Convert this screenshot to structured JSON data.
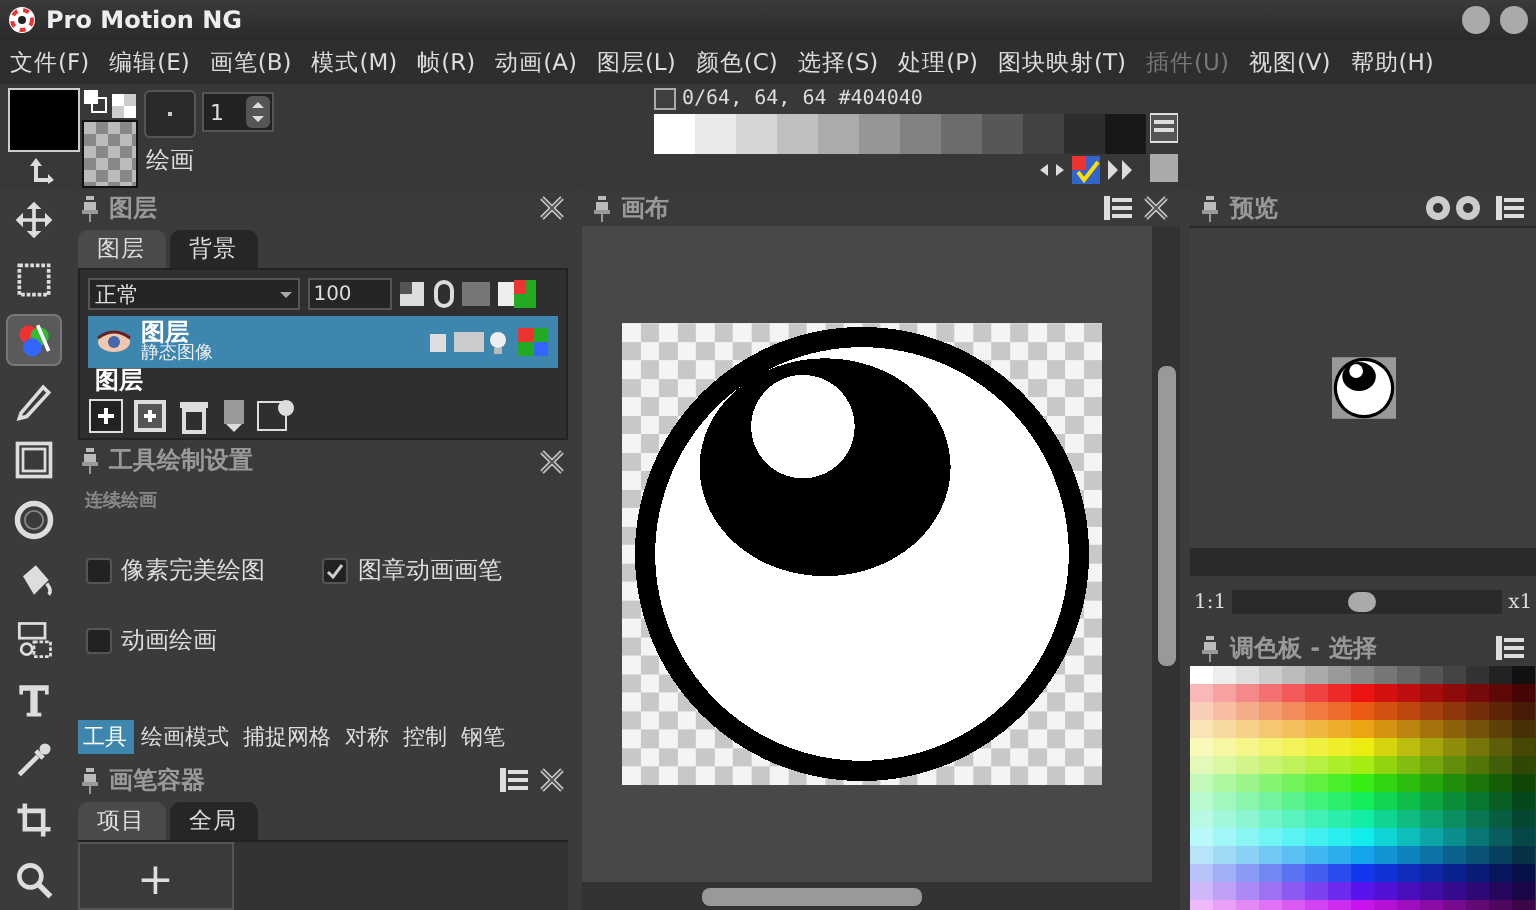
{
  "window": {
    "title": "Pro Motion NG"
  },
  "menu": [
    {
      "label": "文件(F)",
      "disabled": false
    },
    {
      "label": "编辑(E)",
      "disabled": false
    },
    {
      "label": "画笔(B)",
      "disabled": false
    },
    {
      "label": "模式(M)",
      "disabled": false
    },
    {
      "label": "帧(R)",
      "disabled": false
    },
    {
      "label": "动画(A)",
      "disabled": false
    },
    {
      "label": "图层(L)",
      "disabled": false
    },
    {
      "label": "颜色(C)",
      "disabled": false
    },
    {
      "label": "选择(S)",
      "disabled": false
    },
    {
      "label": "处理(P)",
      "disabled": false
    },
    {
      "label": "图块映射(T)",
      "disabled": false
    },
    {
      "label": "插件(U)",
      "disabled": true
    },
    {
      "label": "视图(V)",
      "disabled": false
    },
    {
      "label": "帮助(H)",
      "disabled": false
    }
  ],
  "toolbar": {
    "brush_size": "1",
    "mode_label": "绘画",
    "color_info": "0/64, 64, 64 #404040"
  },
  "tools": [
    {
      "kind": "move",
      "selected": false
    },
    {
      "kind": "select",
      "selected": false
    },
    {
      "kind": "color",
      "selected": true
    },
    {
      "kind": "pencil",
      "selected": false
    },
    {
      "kind": "rect",
      "selected": false
    },
    {
      "kind": "ring",
      "selected": false
    },
    {
      "kind": "fill",
      "selected": false
    },
    {
      "kind": "stamp",
      "selected": false
    },
    {
      "kind": "text",
      "selected": false
    },
    {
      "kind": "picker",
      "selected": false
    },
    {
      "kind": "crop",
      "selected": false
    },
    {
      "kind": "zoom",
      "selected": false
    }
  ],
  "layers_panel": {
    "title": "图层",
    "tabs": [
      {
        "label": "图层",
        "selected": true
      },
      {
        "label": "背景",
        "selected": false
      }
    ],
    "blend_mode": "正常",
    "opacity": "100",
    "layers": [
      {
        "name": "图层",
        "subtitle": "静态图像",
        "selected": true
      },
      {
        "name": "图层",
        "selected": false
      }
    ]
  },
  "tool_settings": {
    "title": "工具绘制设置",
    "section": "连续绘画",
    "options": [
      {
        "label": "像素完美绘图",
        "checked": false
      },
      {
        "label": "图章动画画笔",
        "checked": true
      },
      {
        "label": "动画绘画",
        "checked": false
      }
    ],
    "tabs": [
      {
        "label": "工具",
        "selected": true
      },
      {
        "label": "绘画模式",
        "selected": false
      },
      {
        "label": "捕捉网格",
        "selected": false
      },
      {
        "label": "对称",
        "selected": false
      },
      {
        "label": "控制",
        "selected": false
      },
      {
        "label": "钢笔",
        "selected": false
      }
    ]
  },
  "brush_panel": {
    "title": "画笔容器",
    "tabs": [
      {
        "label": "项目",
        "selected": true
      },
      {
        "label": "全局",
        "selected": false
      }
    ],
    "add_label": "+"
  },
  "canvas_panel": {
    "title": "画布"
  },
  "preview_panel": {
    "title": "预览",
    "ratio": "1:1",
    "factor": "x1",
    "zoom": {
      "level": 0.48
    }
  },
  "palette_panel": {
    "title": "调色板 - 选择"
  }
}
